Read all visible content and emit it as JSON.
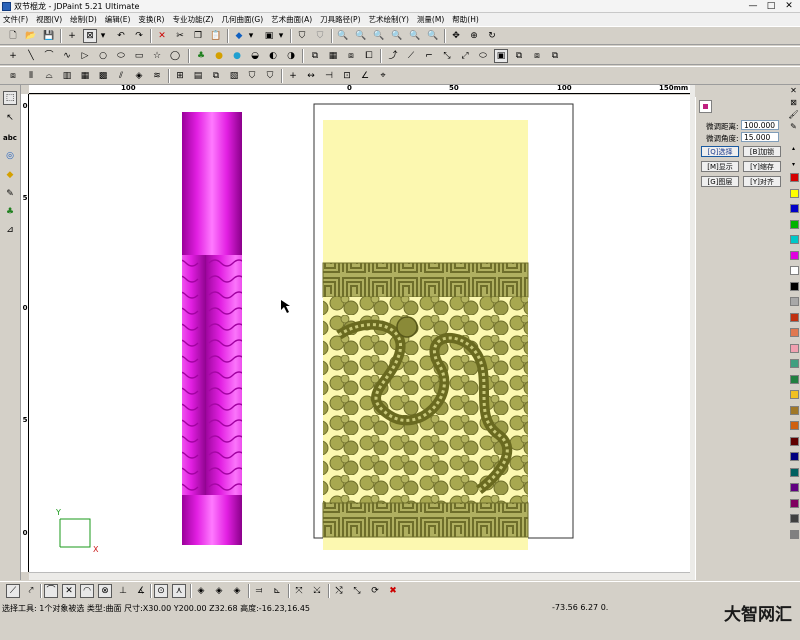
{
  "window": {
    "title": "双节棍龙 - JDPaint 5.21 Ultimate",
    "controls": [
      "—",
      "□",
      "✕"
    ]
  },
  "menu": [
    "文件(F)",
    "视图(V)",
    "绘制(D)",
    "编辑(E)",
    "变换(R)",
    "专业功能(Z)",
    "几何曲面(G)",
    "艺术曲面(A)",
    "刀具路径(P)",
    "艺术绘制(Y)",
    "测量(M)",
    "帮助(H)"
  ],
  "ruler": {
    "unit": "150mm",
    "h_labels": [
      "100",
      "0",
      "50",
      "100"
    ],
    "v_labels": [
      "0",
      "5",
      "0",
      "5",
      "0"
    ]
  },
  "axes": {
    "x": "X",
    "y": "Y"
  },
  "panel": {
    "dist_label": "微调距离:",
    "dist_value": "100.000",
    "angle_label": "微调角度:",
    "angle_value": "15.000",
    "buttons": [
      "[Q]选择",
      "[B]加锁",
      "[M]显示",
      "[Y]缩存",
      "[G]图层",
      "[Y]对齐"
    ]
  },
  "palette": [
    "#d40000",
    "#ffff00",
    "#0000c8",
    "#00b400",
    "#00c8c8",
    "#e000e0",
    "#ffffff",
    "#000000",
    "#a8a8a8",
    "#c03010",
    "#e07850",
    "#f0a0b0",
    "#40a080",
    "#208040",
    "#f0c020",
    "#a07828",
    "#d06010",
    "#600000",
    "#000080",
    "#006060",
    "#600080",
    "#800060",
    "#404040",
    "#808080"
  ],
  "status": {
    "text": "选择工具: 1个对象被选 类型:曲面 尺寸:X30.00 Y200.00 Z32.68 高度:-16.23,16.45",
    "coords": "-73.56 6.27 0."
  },
  "watermark": "大智网汇",
  "colors": {
    "pillar": "#e21fe2",
    "panel_bg": "#fcf8b0",
    "relief": "#9a9a48"
  }
}
